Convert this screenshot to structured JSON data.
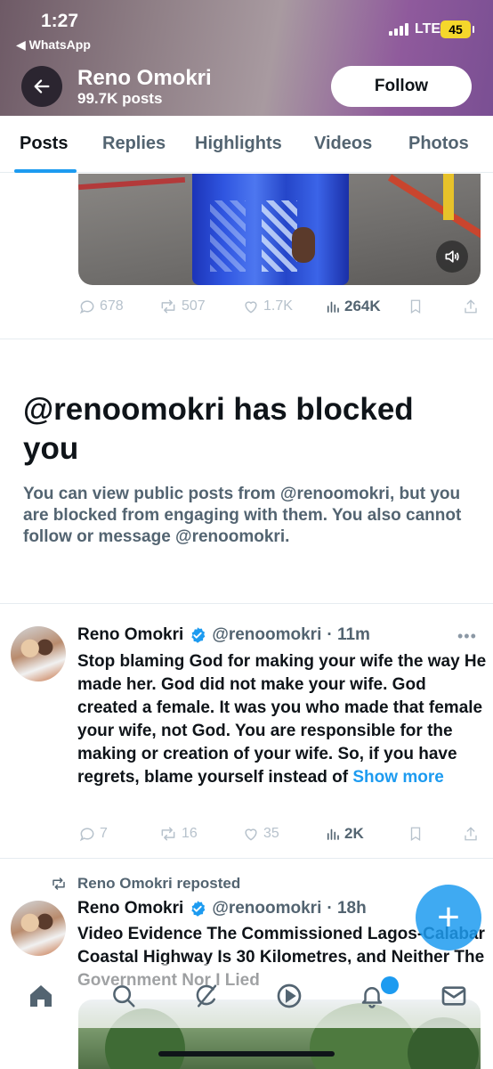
{
  "status": {
    "time": "1:27",
    "back_app": "◀ WhatsApp",
    "network": "LTE",
    "battery": "45"
  },
  "profile": {
    "name": "Reno Omokri",
    "posts_count": "99.7K posts",
    "follow_label": "Follow"
  },
  "tabs": [
    "Posts",
    "Replies",
    "Highlights",
    "Videos",
    "Photos"
  ],
  "post1_actions": {
    "replies": "678",
    "reposts": "507",
    "likes": "1.7K",
    "views": "264K"
  },
  "blocked": {
    "title": "@renoomokri has blocked you",
    "description": "You can view public posts from @renoomokri, but you are blocked from engaging with them. You also cannot follow or message @renoomokri."
  },
  "tweet2": {
    "name": "Reno Omokri",
    "handle": "@renoomokri",
    "time": "· 11m",
    "text": "Stop blaming God for making your wife the way He made her. God did not make your wife. God created a female. It was you who made that female your wife, not God. You are responsible for the making or creation of your wife. So, if you have regrets, blame yourself instead of",
    "show_more": "Show more",
    "replies": "7",
    "reposts": "16",
    "likes": "35",
    "views": "2K"
  },
  "tweet3": {
    "repost_label": "Reno Omokri reposted",
    "name": "Reno Omokri",
    "handle": "@renoomokri",
    "time": "· 18h",
    "text": "Video Evidence The Commissioned Lagos-Calabar Coastal Highway Is 30 Kilometres, and Neither The Government Nor I Lied"
  },
  "icons": {
    "back": "arrow-left-icon",
    "sound": "speaker-icon",
    "reply": "speech-bubble-icon",
    "repost": "repost-arrows-icon",
    "like": "heart-icon",
    "views": "bar-chart-icon",
    "bookmark": "bookmark-icon",
    "share": "share-icon",
    "verified": "verified-badge-icon",
    "compose": "plus-icon",
    "nav": [
      "home-icon",
      "search-icon",
      "grok-icon",
      "video-icon",
      "bell-icon",
      "mail-icon"
    ]
  },
  "colors": {
    "accent": "#1d9bf0",
    "text_primary": "#0f1419",
    "text_secondary": "#536471",
    "battery": "#f5d72b"
  }
}
